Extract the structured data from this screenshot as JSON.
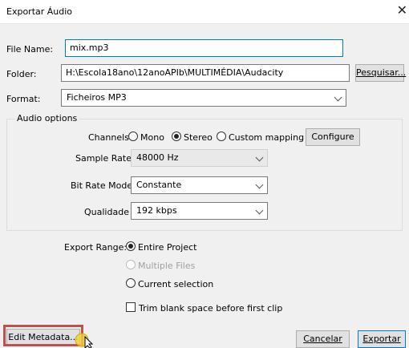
{
  "window": {
    "title": "Exportar Áudio",
    "close_glyph": "✕"
  },
  "file_name": {
    "label": "File Name:",
    "value": "mix.mp3"
  },
  "folder": {
    "label": "Folder:",
    "value": "H:\\Escola18ano\\12anoAPIb\\MULTIMÉDIA\\Audacity",
    "browse_label": "Pesquisar..."
  },
  "format": {
    "label": "Format:",
    "value": "Ficheiros MP3"
  },
  "audio_options": {
    "title": "Audio options",
    "channels_label": "Channels",
    "channels": [
      {
        "label": "Mono",
        "selected": false
      },
      {
        "label": "Stereo",
        "selected": true
      },
      {
        "label": "Custom mapping",
        "selected": false
      }
    ],
    "configure_label": "Configure",
    "sample_rate": {
      "label": "Sample Rate",
      "value": "48000 Hz"
    },
    "bit_rate_mode": {
      "label": "Bit Rate Mode",
      "value": "Constante"
    },
    "quality": {
      "label": "Qualidade",
      "value": "192 kbps"
    }
  },
  "export_range": {
    "label": "Export Range:",
    "options": [
      {
        "label": "Entire Project",
        "selected": true,
        "disabled": false
      },
      {
        "label": "Multiple Files",
        "selected": false,
        "disabled": true
      },
      {
        "label": "Current selection",
        "selected": false,
        "disabled": false
      }
    ],
    "trim_label": "Trim blank space before first clip",
    "trim_checked": false
  },
  "footer": {
    "edit_metadata_label": "Edit Metadata...",
    "cancel_label": "Cancelar",
    "export_label": "Exportar"
  },
  "icons": {
    "cursor": "pointer-cursor-icon"
  },
  "colors": {
    "accent": "#0078d7",
    "highlight": "#c0504d"
  }
}
